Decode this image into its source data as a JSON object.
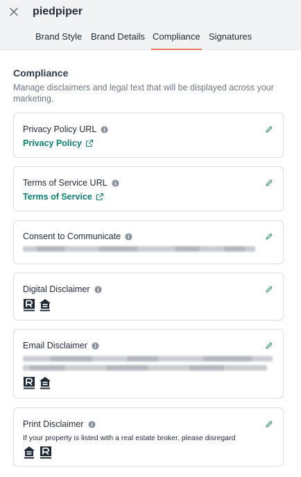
{
  "header": {
    "brand_name": "piedpiper",
    "tabs": [
      {
        "label": "Brand Style",
        "active": false
      },
      {
        "label": "Brand Details",
        "active": false
      },
      {
        "label": "Compliance",
        "active": true
      },
      {
        "label": "Signatures",
        "active": false
      }
    ]
  },
  "compliance": {
    "title": "Compliance",
    "description": "Manage disclaimers and legal text that will be displayed across your marketing.",
    "cards": {
      "privacy": {
        "title": "Privacy Policy URL",
        "link_text": "Privacy Policy"
      },
      "terms": {
        "title": "Terms of Service URL",
        "link_text": "Terms of Service"
      },
      "consent": {
        "title": "Consent to Communicate"
      },
      "digital": {
        "title": "Digital Disclaimer"
      },
      "email": {
        "title": "Email Disclaimer"
      },
      "print": {
        "title": "Print Disclaimer",
        "text": "If your property is listed with a real estate broker, please disregard"
      }
    }
  },
  "colors": {
    "accent": "#e8735a",
    "link": "#0c7d70",
    "edit_icon": "#2f8a6e"
  },
  "icons": [
    "close-icon",
    "info-icon",
    "edit-pencil-icon",
    "external-link-icon",
    "realtor-logo-icon",
    "equal-housing-icon"
  ]
}
